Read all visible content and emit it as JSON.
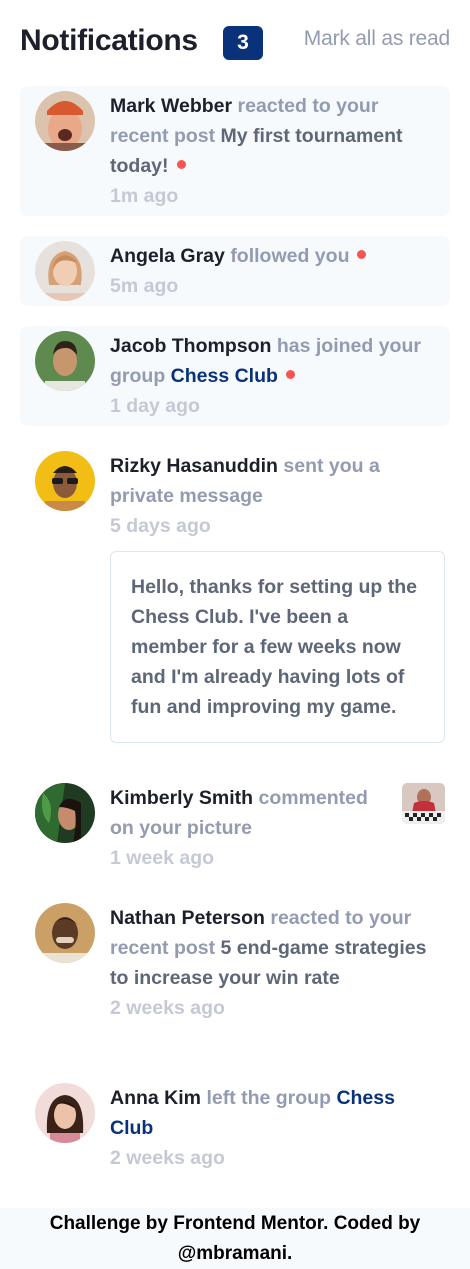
{
  "header": {
    "title": "Notifications",
    "unread_count": "3",
    "mark_all_label": "Mark all as read"
  },
  "notifications": [
    {
      "name": "Mark Webber",
      "action": "reacted to your recent post",
      "post": "My first tournament today!",
      "time": "1m ago",
      "unread": true
    },
    {
      "name": "Angela Gray",
      "action": "followed you",
      "time": "5m ago",
      "unread": true
    },
    {
      "name": "Jacob Thompson",
      "action": "has joined your group",
      "group": "Chess Club",
      "time": "1 day ago",
      "unread": true
    },
    {
      "name": "Rizky Hasanuddin",
      "action": "sent you a private message",
      "time": "5 days ago",
      "message": "Hello, thanks for setting up the Chess Club. I've been a member for a few weeks now and I'm already having lots of fun and improving my game.",
      "unread": false
    },
    {
      "name": "Kimberly Smith",
      "action": "commented on your picture",
      "time": "1 week ago",
      "unread": false
    },
    {
      "name": "Nathan Peterson",
      "action": "reacted to your recent post",
      "post": "5 end-game strategies to increase your win rate",
      "time": "2 weeks ago",
      "unread": false
    },
    {
      "name": "Anna Kim",
      "action": "left the group",
      "group": "Chess Club",
      "time": "2 weeks ago",
      "unread": false
    }
  ],
  "footer": {
    "line1": "Challenge by Frontend Mentor. Coded by",
    "line2": "@mbramani."
  },
  "colors": {
    "accent": "#0a327b",
    "unread_bg": "#f6fafd",
    "dot": "#f65552",
    "muted": "#939bb1",
    "time": "#c5c9d4"
  }
}
